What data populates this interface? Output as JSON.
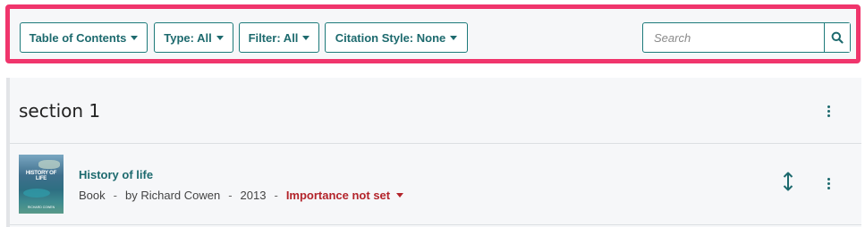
{
  "toolbar": {
    "toc_label": "Table of Contents",
    "type_label": "Type: All",
    "filter_label": "Filter: All",
    "citation_label": "Citation Style: None",
    "search_placeholder": "Search",
    "highlight_color": "#f0356c",
    "accent_color": "#1d6a6e",
    "search_icon": "search-icon",
    "caret_icon": "caret-down-icon"
  },
  "section": {
    "title": "section 1",
    "menu_icon": "kebab-icon"
  },
  "item": {
    "title": "History of life",
    "type": "Book",
    "separator": "-",
    "author": "by Richard Cowen",
    "year": "2013",
    "importance": "Importance not set",
    "importance_color": "#b3242b",
    "cover_title": "HISTORY OF LIFE",
    "cover_author": "RICHARD COWEN",
    "move_icon": "move-vertical-icon",
    "menu_icon": "kebab-icon"
  }
}
